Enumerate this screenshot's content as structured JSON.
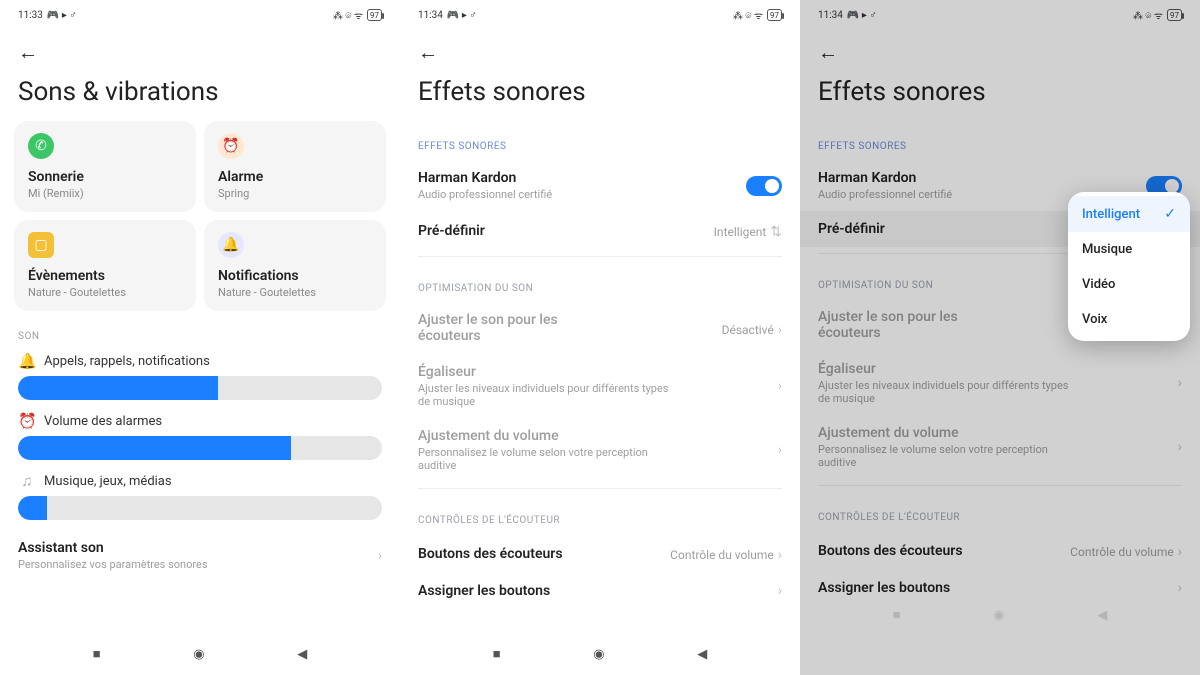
{
  "status": {
    "time1": "11:33",
    "time2": "11:34",
    "icons_left": "🎮 ▸ ♂",
    "icons_right": "⁂ ⌾ ᯤ",
    "battery": "97"
  },
  "s1": {
    "title": "Sons & vibrations",
    "cards": [
      {
        "title": "Sonnerie",
        "sub": "Mi (Remiix)"
      },
      {
        "title": "Alarme",
        "sub": "Spring"
      },
      {
        "title": "Évènements",
        "sub": "Nature - Goutelettes"
      },
      {
        "title": "Notifications",
        "sub": "Nature - Goutelettes"
      }
    ],
    "section_son": "SON",
    "sliders": [
      {
        "label": "Appels, rappels, notifications",
        "percent": 55
      },
      {
        "label": "Volume des alarmes",
        "percent": 75
      },
      {
        "label": "Musique, jeux, médias",
        "percent": 8
      }
    ],
    "assistant": {
      "title": "Assistant son",
      "sub": "Personnalisez vos paramètres sonores"
    }
  },
  "s2": {
    "title": "Effets sonores",
    "sec1": "EFFETS SONORES",
    "hk": {
      "title": "Harman Kardon",
      "sub": "Audio professionnel certifié"
    },
    "predef": {
      "title": "Pré-définir",
      "value": "Intelligent"
    },
    "sec2": "OPTIMISATION DU SON",
    "opt1": {
      "title": "Ajuster le son pour les écouteurs",
      "value": "Désactivé"
    },
    "opt2": {
      "title": "Égaliseur",
      "sub": "Ajuster les niveaux individuels pour différents types de musique"
    },
    "opt3": {
      "title": "Ajustement du volume",
      "sub": "Personnalisez le volume selon votre perception auditive"
    },
    "sec3": "CONTRÔLES DE L'ÉCOUTEUR",
    "ctrl1": {
      "title": "Boutons des écouteurs",
      "value": "Contrôle du volume"
    },
    "ctrl2": {
      "title": "Assigner les boutons"
    }
  },
  "popup": {
    "options": [
      "Intelligent",
      "Musique",
      "Vidéo",
      "Voix"
    ],
    "selected": "Intelligent"
  }
}
